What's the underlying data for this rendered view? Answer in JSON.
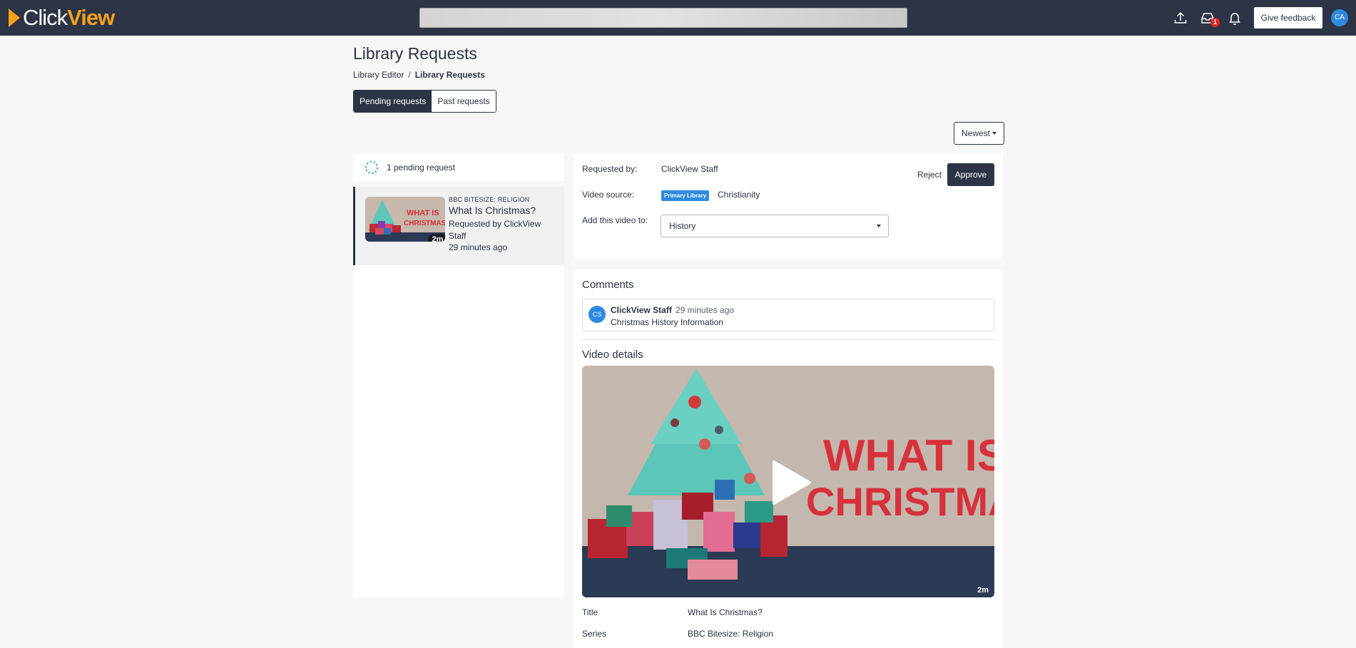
{
  "brand": {
    "name_part1": "Click",
    "name_part2": "View",
    "accent": "#f5a01a",
    "nav_bg": "#2c3445"
  },
  "topbar": {
    "icons": [
      "upload-icon",
      "inbox-icon",
      "bell-icon"
    ],
    "inbox_count": "1",
    "feedback_label": "Give feedback",
    "user_initials": "CA"
  },
  "page": {
    "title": "Library Requests",
    "breadcrumb": {
      "parent": "Library Editor",
      "separator": "/",
      "current": "Library Requests"
    },
    "tabs": [
      {
        "label": "Pending requests",
        "active": true
      },
      {
        "label": "Past requests",
        "active": false
      }
    ],
    "sort": {
      "label": "Newest"
    }
  },
  "requests_panel": {
    "count_label": "1 pending request",
    "items": [
      {
        "series": "BBC BITESIZE: RELIGION",
        "title": "What Is Christmas?",
        "requested_by": "Requested by ClickView Staff",
        "time": "29 minutes ago",
        "duration": "2m"
      }
    ]
  },
  "request_detail": {
    "requested_by_label": "Requested by:",
    "requested_by_value": "ClickView Staff",
    "video_source_label": "Video source:",
    "video_source_badge": "Primary Library",
    "video_source_value": "Christianity",
    "add_to_label": "Add this video to:",
    "add_to_value": "History",
    "reject_label": "Reject",
    "approve_label": "Approve"
  },
  "comments": {
    "heading": "Comments",
    "items": [
      {
        "initials": "CS",
        "author": "ClickView Staff",
        "time": "29 minutes ago",
        "text": "Christmas History Information"
      }
    ]
  },
  "video_details": {
    "heading": "Video details",
    "thumbnail_text_line1": "WHAT IS",
    "thumbnail_text_line2": "CHRISTMAS?",
    "duration": "2m",
    "fields": [
      {
        "label": "Title",
        "value": "What Is Christmas?"
      },
      {
        "label": "Series",
        "value": "BBC Bitesize: Religion"
      }
    ]
  }
}
